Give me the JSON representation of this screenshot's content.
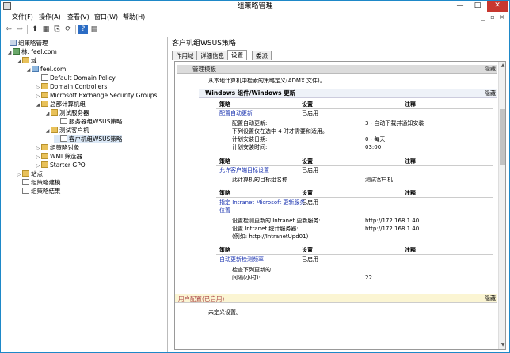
{
  "window": {
    "title": "组策略管理",
    "minimize": "—",
    "maximize": "□",
    "close": "✕"
  },
  "menu": [
    "文件(F)",
    "操作(A)",
    "查看(V)",
    "窗口(W)",
    "帮助(H)"
  ],
  "mdi": {
    "min": "_",
    "max": "▫",
    "close": "×"
  },
  "toolbar": {
    "back": "⇦",
    "forward": "⇨",
    "up": "⬆",
    "view": "▦",
    "copy": "⎘",
    "refresh": "⟳",
    "help": "?",
    "props": "▤"
  },
  "tree": [
    {
      "label": "组策略管理",
      "toggle": "",
      "icon": "root"
    },
    {
      "label": "林: feel.com",
      "toggle": "◢",
      "icon": "forest"
    },
    {
      "label": "域",
      "toggle": "◢",
      "icon": "folder"
    },
    {
      "label": "feel.com",
      "toggle": "◢",
      "icon": "domain"
    },
    {
      "label": "Default Domain Policy",
      "toggle": "",
      "icon": "gpo"
    },
    {
      "label": "Domain Controllers",
      "toggle": "▷",
      "icon": "folder"
    },
    {
      "label": "Microsoft Exchange Security Groups",
      "toggle": "▷",
      "icon": "folder"
    },
    {
      "label": "总部计算机组",
      "toggle": "◢",
      "icon": "folder"
    },
    {
      "label": "测试服务器",
      "toggle": "◢",
      "icon": "folder"
    },
    {
      "label": "服务器组WSUS策略",
      "toggle": "",
      "icon": "gpo"
    },
    {
      "label": "测试客户机",
      "toggle": "◢",
      "icon": "folder"
    },
    {
      "label": "客户机组WSUS策略",
      "toggle": "",
      "icon": "gpo",
      "selected": true
    },
    {
      "label": "组策略对象",
      "toggle": "▷",
      "icon": "folder"
    },
    {
      "label": "WMI 筛选器",
      "toggle": "▷",
      "icon": "folder"
    },
    {
      "label": "Starter GPO",
      "toggle": "▷",
      "icon": "folder"
    },
    {
      "label": "站点",
      "toggle": "▷",
      "icon": "folder"
    },
    {
      "label": "组策略建模",
      "toggle": "",
      "icon": "gpo"
    },
    {
      "label": "组策略结果",
      "toggle": "",
      "icon": "gpo"
    }
  ],
  "right": {
    "title": "客户机组WSUS策略",
    "tabs": [
      "作用域",
      "详细信息",
      "设置",
      "委派"
    ],
    "active_tab": "设置"
  },
  "report": {
    "hide": "隐藏",
    "admin_templates": "管理模板",
    "admin_desc": "从本地计算机中检索的策略定义(ADMX 文件)。",
    "wu_section": "Windows 组件/Windows 更新",
    "col_policy": "策略",
    "col_setting": "设置",
    "col_comment": "注释",
    "policies": [
      {
        "name": "配置自动更新",
        "setting": "已启用",
        "details": [
          [
            "配置自动更新:",
            "3 - 自动下载并通知安装"
          ],
          [
            "下列设置仅在选中 4 时才需要和适用。",
            ""
          ],
          [
            "计划安装日期:",
            "0 - 每天"
          ],
          [
            "计划安装时间:",
            "03:00"
          ]
        ]
      },
      {
        "name": "允许客户端目标设置",
        "setting": "已启用",
        "details": [
          [
            "此计算机的目标组名称",
            "测试客户机"
          ]
        ]
      },
      {
        "name": "指定 Intranet Microsoft 更新服务",
        "name2": "位置",
        "setting": "已启用",
        "details": [
          [
            "设置检测更新的 Intranet 更新服务:",
            "http://172.168.1.40"
          ],
          [
            "设置 Intranet 统计服务器:",
            "http://172.168.1.40"
          ],
          [
            "(例如: http://IntranetUpd01)",
            ""
          ]
        ]
      },
      {
        "name": "自动更新检测频率",
        "setting": "已启用",
        "details": [
          [
            "检查下列更新的",
            ""
          ],
          [
            "间隔(小时):",
            "22"
          ]
        ]
      }
    ],
    "user_config": "用户配置(已启用)",
    "undefined": "未定义设置。"
  },
  "colors": {
    "accent": "#1e88c8",
    "close": "#c7372f",
    "link": "#1a33b0"
  }
}
